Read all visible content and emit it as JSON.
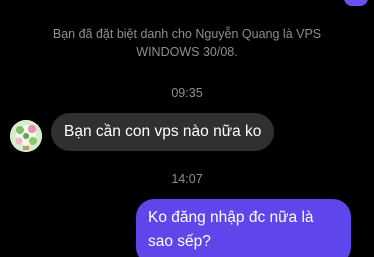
{
  "conversation": {
    "system_notice": "Bạn đã đặt biệt danh cho Nguyễn Quang là VPS WINDOWS 30/08.",
    "timestamps": [
      "09:35",
      "14:07"
    ],
    "incoming_message": "Bạn cần con vps nào nữa ko",
    "outgoing_message": "Ko đăng nhập đc nữa là sao sếp?"
  },
  "colors": {
    "background": "#000000",
    "incoming_bubble": "#303030",
    "outgoing_bubble": "#5f46ea",
    "meta_text": "#8e8e93"
  }
}
